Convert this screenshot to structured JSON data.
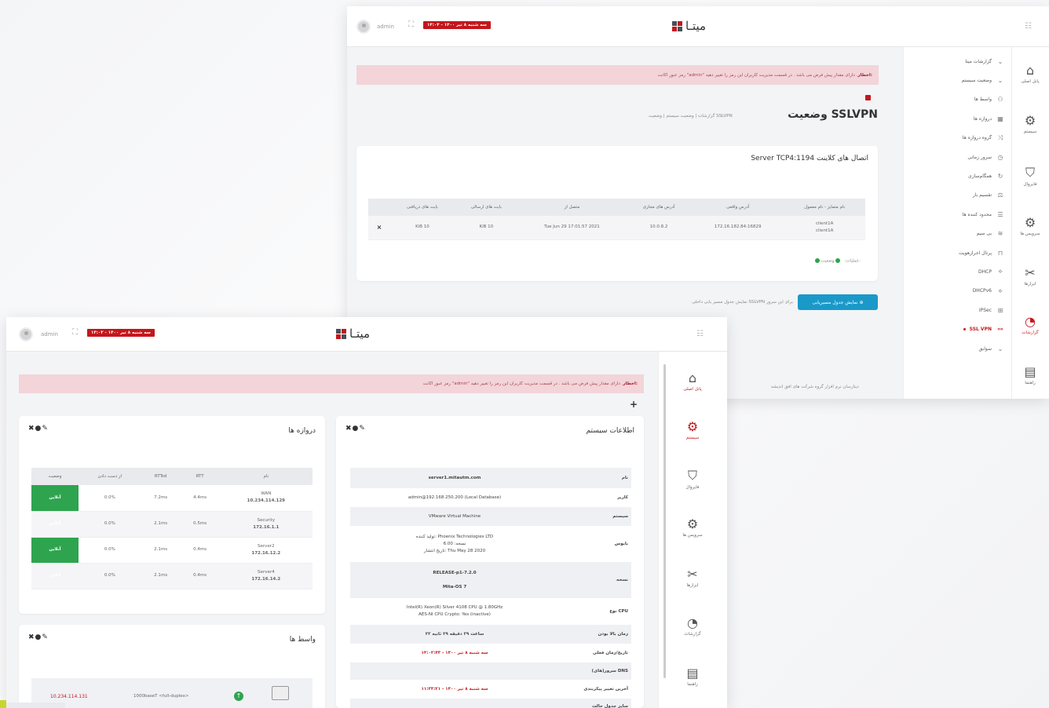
{
  "common": {
    "user": "admin",
    "date_top": "سه شنبه ۸ تیر ۱۴۰۰ - ۱۴:۰۴",
    "date_bottom": "سه شنبه ۸ تیر ۱۴۰۰ - ۱۴:۰۳",
    "logo_text": "میتـا",
    "alert_label": "اخطار:",
    "alert_text": " رمز عبور اکانت \"admin\" دارای مقدار پیش فرض می باشد . در قسمت مدیریت کاربران این رمز را تغییر دهید .",
    "footer": "دیتارسان نرم افزار گروه شرکت های افق اندیشه"
  },
  "rail": [
    {
      "label": "پانل اصلی",
      "icon": "⌂"
    },
    {
      "label": "سیستم",
      "icon": "⚙"
    },
    {
      "label": "فایروال",
      "icon": "⛉"
    },
    {
      "label": "سرویس ها",
      "icon": "⚙"
    },
    {
      "label": "ابزارها",
      "icon": "✂"
    },
    {
      "label": "گزارشات",
      "icon": "◔"
    },
    {
      "label": "راهنما",
      "icon": "▤"
    }
  ],
  "menu": [
    {
      "label": "گزارشات میتا",
      "icon": "⌄"
    },
    {
      "label": "وضعیت سیستم",
      "icon": "⌄"
    },
    {
      "label": "واسط ها",
      "icon": "⚇"
    },
    {
      "label": "دروازه ها",
      "icon": "▦"
    },
    {
      "label": "گروه دروازه ها",
      "icon": "⤨"
    },
    {
      "label": "سرور زمانی",
      "icon": "◷"
    },
    {
      "label": "همگام‌سازی",
      "icon": "↻"
    },
    {
      "label": "تقسیم بار",
      "icon": "⚖"
    },
    {
      "label": "محدود کننده ها",
      "icon": "☰"
    },
    {
      "label": "بی سیم",
      "icon": "≋"
    },
    {
      "label": "پرتال احرازهویت",
      "icon": "⊓"
    },
    {
      "label": "DHCP",
      "icon": "⟡"
    },
    {
      "label": "DHCPv6",
      "icon": "⟡"
    },
    {
      "label": "IPSec",
      "icon": "⊞"
    },
    {
      "label": "SSL VPN",
      "icon": "⚯"
    },
    {
      "label": "سوابق",
      "icon": "⌄"
    }
  ],
  "ssl": {
    "title": "وضعیت SSLVPN",
    "breadcrumb": "گزارشات  |  وضعیت سیستم  |  وضعیت SSLVPN",
    "card_title": "Server TCP4:1194 اتصال های کلاینت",
    "columns": [
      "نام متمایز - نام معمول",
      "آدرس واقعی",
      "آدرس های مجازی",
      "متصل از",
      "بایت های ارسالی",
      "بایت های دریافتی"
    ],
    "row": [
      "client1A\nclient1A",
      "172.16.182.84:16829",
      "10.0.8.2",
      "Tue Jun 29 17:01:57 2021",
      "KiB 10",
      "KiB 10"
    ],
    "disconnect": "×",
    "status_label": "وضعیت:",
    "ops_label": "عملیات:",
    "route_button": "نمایش جدول مسیریابی",
    "route_hint": "نمایش جدول مسیر یابی داخلی SSLVPN برای این سرور"
  },
  "dashboard": {
    "plus": "+",
    "controls": "✖●✎",
    "sysinfo_title": "اطلاعات سیستم",
    "sysinfo": [
      {
        "k": "نام",
        "v": "server1.mitautm.com",
        "bold": true
      },
      {
        "k": "کاربر",
        "v": "admin@192.168.250.200 (Local Database)"
      },
      {
        "k": "سیستم",
        "v": "VMware Virtual Machine"
      },
      {
        "k": "بایوس",
        "v": "تولید کننده: Phoenix Technologies LTD\nنسخه: 6.00\nتاریخ انتشار: Thu May 28 2020",
        "bold": true
      },
      {
        "k": "نسخه",
        "v": "RELEASE-p1-7.2.0\n\nMita-OS 7",
        "bold": true
      },
      {
        "k": "نوع CPU",
        "v": "Intel(R) Xeon(R) Silver 4108 CPU @ 1.80GHz\nAES-NI CPU Crypto: Yes (inactive)"
      },
      {
        "k": "زمان بالا بودن",
        "v": "۲۲ ساعت ۲۹ دقیقه ۲۹ ثانیه",
        "bold": true
      },
      {
        "k": "تاریخ/زمان فعلی",
        "v": "سه شنبه ۸ تیر ۱۴۰۰ - ۱۴:۰۲:۴۳",
        "red": true
      },
      {
        "k": "سرور(های) DNS",
        "v": ""
      },
      {
        "k": "آخرین تغییر پیکربندی",
        "v": "سه شنبه ۸ تیر ۱۴۰۰ - ۱۱:۳۳:۲۱",
        "red": true
      },
      {
        "k": "سایز جدول حالت",
        "v": ""
      }
    ],
    "gateways_title": "دروازه ها",
    "gw_columns": [
      "نام",
      "RTT",
      "RTTsd",
      "از دست دادن",
      "وضعیت"
    ],
    "gateways": [
      {
        "name": "WAN",
        "ip": "10.234.114.129",
        "rtt": "4.4ms",
        "rttsd": "7.2ms",
        "loss": "0.0%",
        "status": "آنلاین"
      },
      {
        "name": "Security",
        "ip": "172.16.1.1",
        "rtt": "0.5ms",
        "rttsd": "2.1ms",
        "loss": "0.0%",
        "status": "آنلاین"
      },
      {
        "name": "Server2",
        "ip": "172.16.12.2",
        "rtt": "0.4ms",
        "rttsd": "2.1ms",
        "loss": "0.0%",
        "status": "آنلاین"
      },
      {
        "name": "Server4",
        "ip": "172.16.14.2",
        "rtt": "0.4ms",
        "rttsd": "2.1ms",
        "loss": "0.0%",
        "status": "آنلاین"
      }
    ],
    "interfaces_title": "واسط ها",
    "iface": {
      "ip": "10.234.114.131",
      "media": "1000baseT <full-duplex>",
      "status": "↑"
    }
  }
}
